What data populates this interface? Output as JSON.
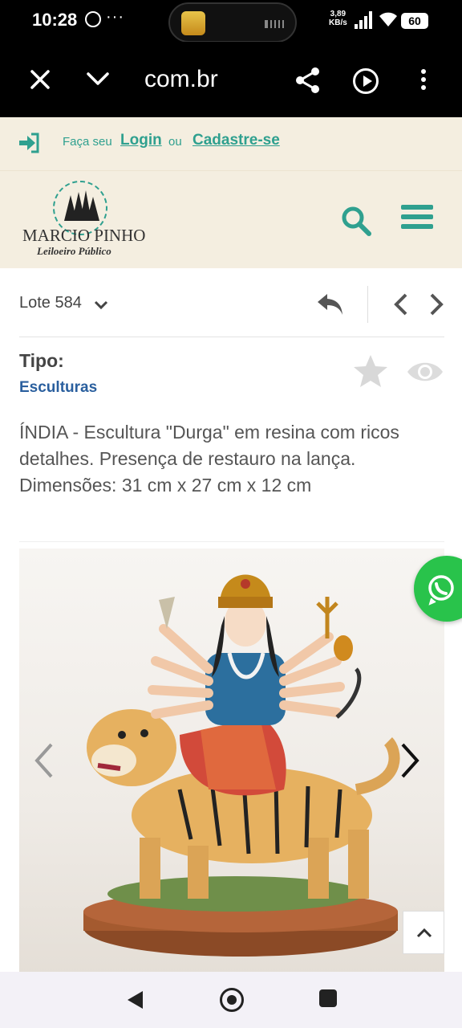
{
  "status_bar": {
    "time": "10:28",
    "dots": "···",
    "speed_value": "3,89",
    "speed_unit": "KB/s",
    "battery": "60"
  },
  "browser": {
    "url": "com.br",
    "icons": [
      "close-icon",
      "chevron-down-icon",
      "share-icon",
      "play-icon",
      "more-icon"
    ]
  },
  "login_strip": {
    "prefix": "Faça seu",
    "login_link": "Login",
    "separator": "ou",
    "register_link": "Cadastre-se"
  },
  "logo": {
    "name": "MARCIO PINHO",
    "subtitle": "Leiloeiro Público"
  },
  "lot": {
    "label": "Lote 584"
  },
  "item": {
    "type_label": "Tipo:",
    "type_value": "Esculturas",
    "description": "ÍNDIA - Escultura \"Durga\" em resina com ricos detalhes. Presença de restauro na lança. Dimensões: 31 cm x 27 cm x 12 cm"
  },
  "colors": {
    "brand_teal": "#2fa08f",
    "header_bg": "#f4eee0",
    "link_blue": "#2a5f9e",
    "whatsapp_green": "#29c34b"
  }
}
